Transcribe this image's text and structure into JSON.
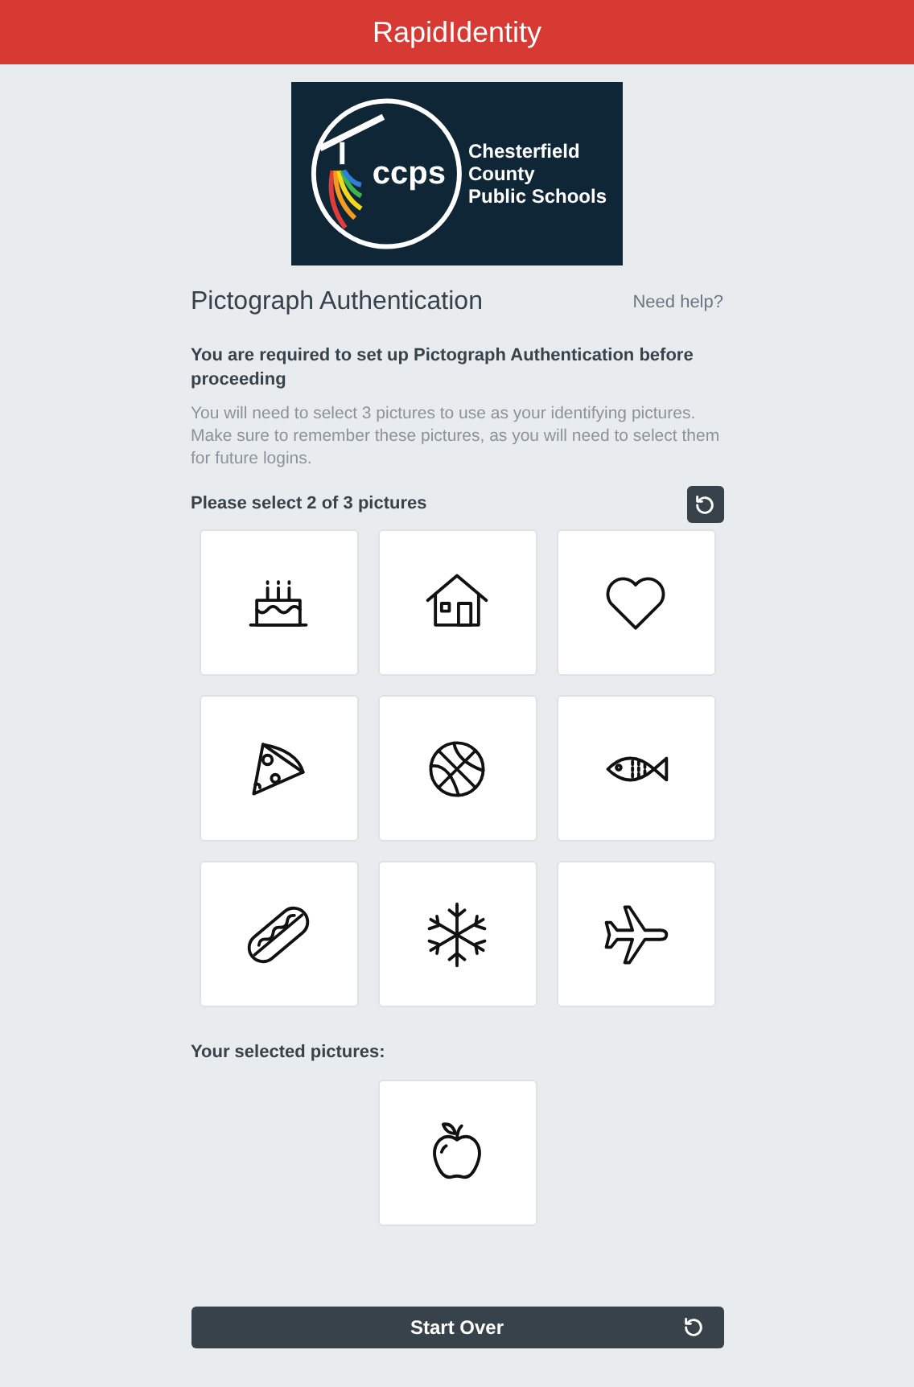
{
  "header": {
    "title": "RapidIdentity"
  },
  "logo": {
    "mark": "ccps",
    "name_lines": [
      "Chesterfield",
      "County",
      "Public Schools"
    ]
  },
  "title": "Pictograph Authentication",
  "help_link": "Need help?",
  "notice": "You are required to set up Pictograph Authentication before proceeding",
  "description": "You will need to select 3 pictures to use as your identifying pictures. Make sure to remember these pictures, as you will need to select them for future logins.",
  "prompt": "Please select 2 of 3 pictures",
  "pictures": [
    {
      "kind": "cake"
    },
    {
      "kind": "house"
    },
    {
      "kind": "heart"
    },
    {
      "kind": "pizza"
    },
    {
      "kind": "ball"
    },
    {
      "kind": "fish"
    },
    {
      "kind": "hotdog"
    },
    {
      "kind": "snowflake"
    },
    {
      "kind": "airplane"
    }
  ],
  "selected_label": "Your selected pictures:",
  "selected_pictures": [
    {
      "kind": "apple"
    }
  ],
  "start_over_button": "Start Over"
}
